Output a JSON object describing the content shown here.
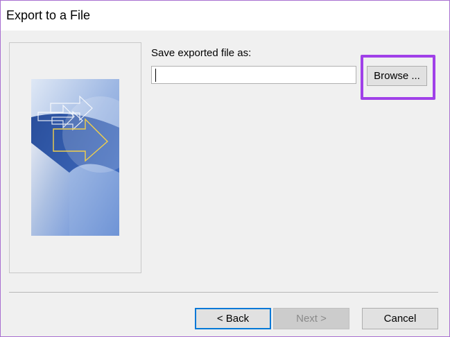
{
  "window": {
    "title": "Export to a File"
  },
  "save": {
    "label": "Save exported file as:",
    "value": "",
    "placeholder": ""
  },
  "buttons": {
    "browse": "Browse ...",
    "back": "< Back",
    "next": "Next >",
    "cancel": "Cancel"
  },
  "colors": {
    "highlight": "#a040e8",
    "default_button_border": "#0078d7"
  }
}
